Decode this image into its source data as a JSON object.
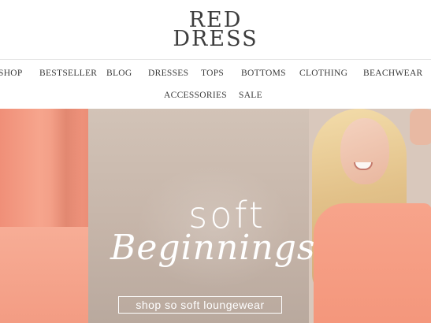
{
  "brand": {
    "line1": "RED",
    "line2": "DRESS"
  },
  "nav": {
    "row1": [
      "SHOP",
      "BESTSELLER",
      "BLOG",
      "DRESSES",
      "TOPS",
      "BOTTOMS",
      "CLOTHING",
      "BEACHWEAR"
    ],
    "row2": [
      "ACCESSORIES",
      "SALE"
    ]
  },
  "hero": {
    "headline_1": "soft",
    "headline_2": "Beginnings",
    "cta_label": "shop so soft loungewear"
  },
  "colors": {
    "accent_coral": "#f39c83",
    "backdrop_taupe": "#c6b5a9",
    "text_dark": "#3a3a3a"
  }
}
